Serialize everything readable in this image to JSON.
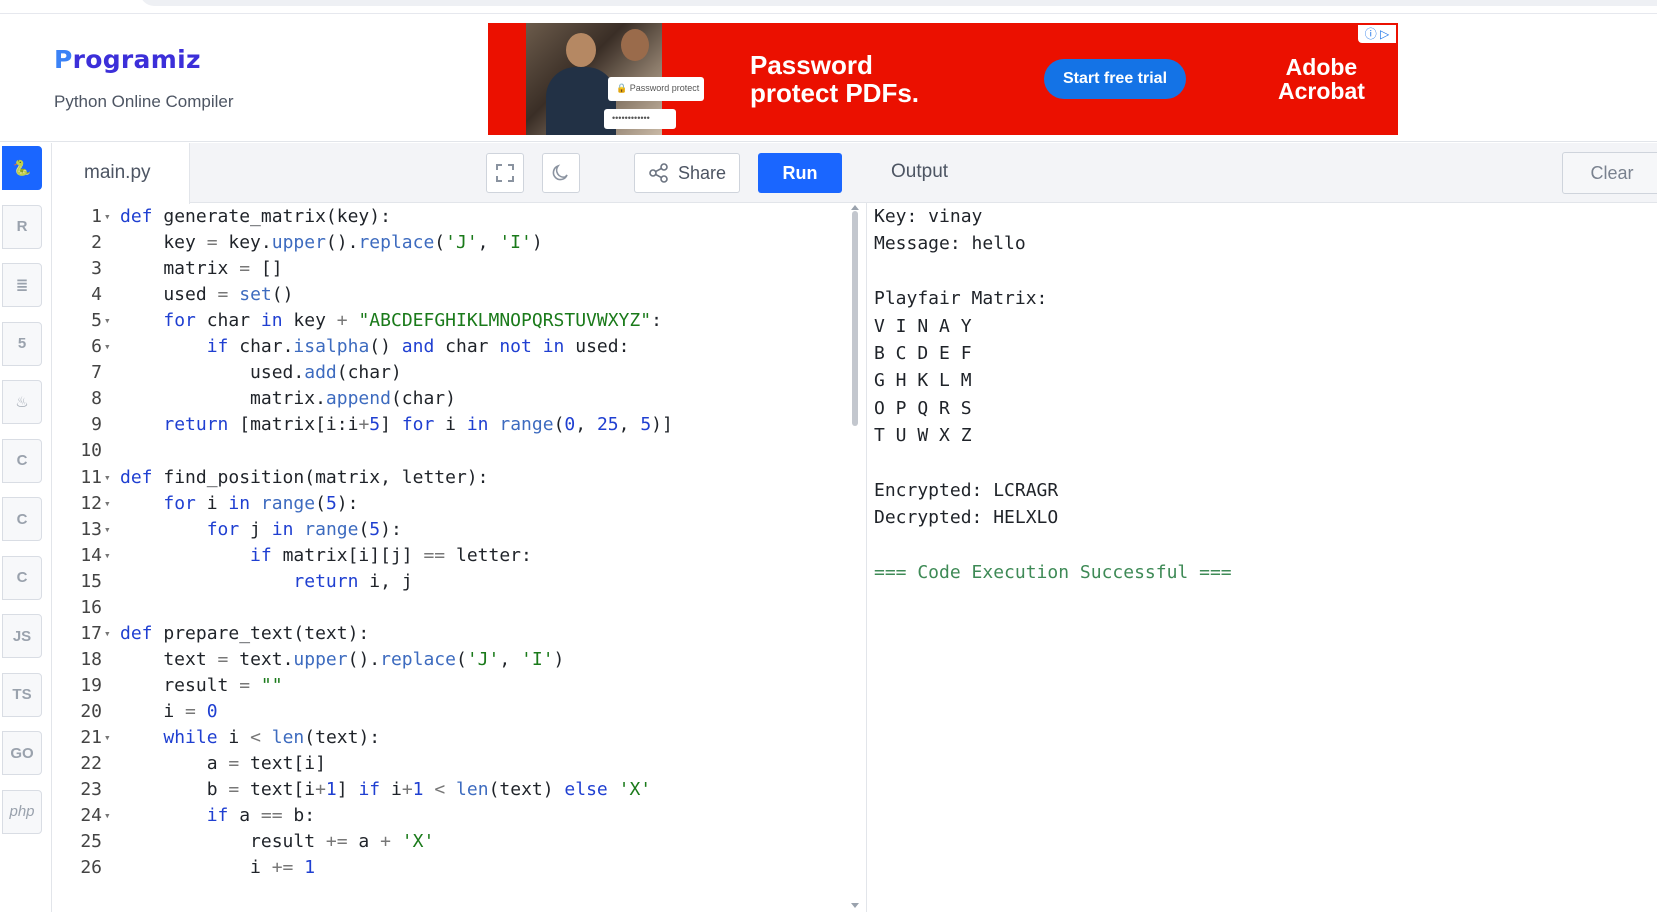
{
  "header": {
    "logo_text": "rogramiz",
    "logo_letter": "P",
    "subtitle": "Python Online Compiler"
  },
  "ad": {
    "headline_line1": "Password",
    "headline_line2": "protect PDFs.",
    "card_label": "Password protect",
    "card_mask": "••••••••••••",
    "cta": "Start free trial",
    "brand_line1": "Adobe",
    "brand_line2": "Acrobat",
    "badge": "ⓘ ▷"
  },
  "rail": {
    "items": [
      {
        "icon": "python-icon",
        "glyph": "🐍",
        "active": true
      },
      {
        "icon": "r-language-icon",
        "glyph": "R",
        "active": false
      },
      {
        "icon": "database-icon",
        "glyph": "≣",
        "active": false
      },
      {
        "icon": "html5-icon",
        "glyph": "5",
        "active": false
      },
      {
        "icon": "java-icon",
        "glyph": "♨",
        "active": false
      },
      {
        "icon": "c-language-icon",
        "glyph": "C",
        "active": false
      },
      {
        "icon": "cpp-icon",
        "glyph": "C",
        "active": false
      },
      {
        "icon": "csharp-icon",
        "glyph": "C",
        "active": false
      },
      {
        "icon": "javascript-icon",
        "glyph": "JS",
        "active": false
      },
      {
        "icon": "typescript-icon",
        "glyph": "TS",
        "active": false
      },
      {
        "icon": "go-icon",
        "glyph": "GO",
        "active": false
      },
      {
        "icon": "php-icon",
        "glyph": "php",
        "active": false
      }
    ]
  },
  "editor": {
    "file_name": "main.py",
    "share_label": "Share",
    "run_label": "Run",
    "lines": [
      {
        "n": "1",
        "fold": true,
        "html": "<span class=\"kw\">def</span> generate_matrix(key):"
      },
      {
        "n": "2",
        "fold": false,
        "html": "    key <span class=\"op\">=</span> key.<span class=\"meth\">upper</span>().<span class=\"meth\">replace</span>(<span class=\"str\">'J'</span>, <span class=\"str\">'I'</span>)"
      },
      {
        "n": "3",
        "fold": false,
        "html": "    matrix <span class=\"op\">=</span> []"
      },
      {
        "n": "4",
        "fold": false,
        "html": "    used <span class=\"op\">=</span> <span class=\"bi\">set</span>()"
      },
      {
        "n": "5",
        "fold": true,
        "html": "    <span class=\"kw\">for</span> char <span class=\"kw\">in</span> key <span class=\"op\">+</span> <span class=\"str\">\"ABCDEFGHIKLMNOPQRSTUVWXYZ\"</span>:"
      },
      {
        "n": "6",
        "fold": true,
        "html": "        <span class=\"kw\">if</span> char.<span class=\"meth\">isalpha</span>() <span class=\"kw\">and</span> char <span class=\"kw\">not</span> <span class=\"kw\">in</span> used:"
      },
      {
        "n": "7",
        "fold": false,
        "html": "            used.<span class=\"meth\">add</span>(char)"
      },
      {
        "n": "8",
        "fold": false,
        "html": "            matrix.<span class=\"meth\">append</span>(char)"
      },
      {
        "n": "9",
        "fold": false,
        "html": "    <span class=\"kw\">return</span> [matrix[i:i<span class=\"op\">+</span><span class=\"num\">5</span>] <span class=\"kw\">for</span> i <span class=\"kw\">in</span> <span class=\"bi\">range</span>(<span class=\"num\">0</span>, <span class=\"num\">25</span>, <span class=\"num\">5</span>)]"
      },
      {
        "n": "10",
        "fold": false,
        "html": ""
      },
      {
        "n": "11",
        "fold": true,
        "html": "<span class=\"kw\">def</span> find_position(matrix, letter):"
      },
      {
        "n": "12",
        "fold": true,
        "html": "    <span class=\"kw\">for</span> i <span class=\"kw\">in</span> <span class=\"bi\">range</span>(<span class=\"num\">5</span>):"
      },
      {
        "n": "13",
        "fold": true,
        "html": "        <span class=\"kw\">for</span> j <span class=\"kw\">in</span> <span class=\"bi\">range</span>(<span class=\"num\">5</span>):"
      },
      {
        "n": "14",
        "fold": true,
        "html": "            <span class=\"kw\">if</span> matrix[i][j] <span class=\"op\">==</span> letter:"
      },
      {
        "n": "15",
        "fold": false,
        "html": "                <span class=\"kw\">return</span> i, j"
      },
      {
        "n": "16",
        "fold": false,
        "html": ""
      },
      {
        "n": "17",
        "fold": true,
        "html": "<span class=\"kw\">def</span> prepare_text(text):"
      },
      {
        "n": "18",
        "fold": false,
        "html": "    text <span class=\"op\">=</span> text.<span class=\"meth\">upper</span>().<span class=\"meth\">replace</span>(<span class=\"str\">'J'</span>, <span class=\"str\">'I'</span>)"
      },
      {
        "n": "19",
        "fold": false,
        "html": "    result <span class=\"op\">=</span> <span class=\"str\">\"\"</span>"
      },
      {
        "n": "20",
        "fold": false,
        "html": "    i <span class=\"op\">=</span> <span class=\"num\">0</span>"
      },
      {
        "n": "21",
        "fold": true,
        "html": "    <span class=\"kw\">while</span> i <span class=\"op\">&lt;</span> <span class=\"bi\">len</span>(text):"
      },
      {
        "n": "22",
        "fold": false,
        "html": "        a <span class=\"op\">=</span> text[i]"
      },
      {
        "n": "23",
        "fold": false,
        "html": "        b <span class=\"op\">=</span> text[i<span class=\"op\">+</span><span class=\"num\">1</span>] <span class=\"kw\">if</span> i<span class=\"op\">+</span><span class=\"num\">1</span> <span class=\"op\">&lt;</span> <span class=\"bi\">len</span>(text) <span class=\"kw\">else</span> <span class=\"str\">'X'</span>"
      },
      {
        "n": "24",
        "fold": true,
        "html": "        <span class=\"kw\">if</span> a <span class=\"op\">==</span> b:"
      },
      {
        "n": "25",
        "fold": false,
        "html": "            result <span class=\"op\">+=</span> a <span class=\"op\">+</span> <span class=\"str\">'X'</span>"
      },
      {
        "n": "26",
        "fold": false,
        "html": "            i <span class=\"op\">+=</span> <span class=\"num\">1</span>"
      }
    ]
  },
  "output": {
    "title": "Output",
    "clear_label": "Clear",
    "lines": [
      "Key: vinay",
      "Message: hello",
      "",
      "Playfair Matrix:",
      "V I N A Y",
      "B C D E F",
      "G H K L M",
      "O P Q R S",
      "T U W X Z",
      "",
      "Encrypted: LCRAGR",
      "Decrypted: HELXLO",
      "",
      "=== Code Execution Successful ==="
    ]
  }
}
